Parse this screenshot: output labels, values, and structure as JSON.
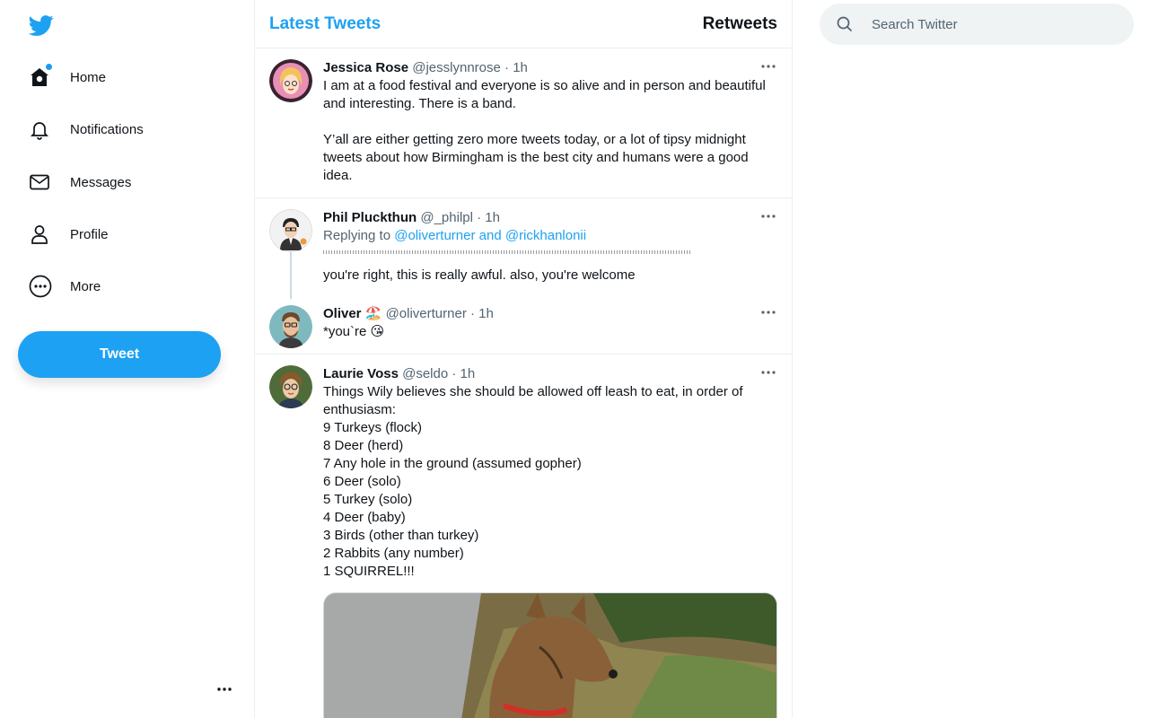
{
  "sidebar": {
    "items": [
      {
        "label": "Home",
        "icon": "home-icon"
      },
      {
        "label": "Notifications",
        "icon": "bell-icon"
      },
      {
        "label": "Messages",
        "icon": "envelope-icon"
      },
      {
        "label": "Profile",
        "icon": "person-icon"
      },
      {
        "label": "More",
        "icon": "more-circle-icon"
      }
    ],
    "tweet_button": "Tweet"
  },
  "header": {
    "tab_latest": "Latest Tweets",
    "tab_retweets": "Retweets"
  },
  "search": {
    "placeholder": "Search Twitter"
  },
  "tweets": [
    {
      "name": "Jessica Rose",
      "handle": "@jesslynnrose",
      "sep": " · ",
      "time": "1h",
      "text": "I am at a food festival and everyone is so alive and in person and beautiful\nand interesting. There is a band.\n\nY’all are either getting zero more tweets today, or a lot of tipsy midnight\ntweets about how Birmingham is the best city and humans were a good\nidea."
    },
    {
      "name": "Phil Pluckthun",
      "handle": "@_philpl",
      "sep": " · ",
      "time": "1h",
      "replying_prefix": "Replying to ",
      "replying_users": "@oliverturner and @rickhanlonii",
      "text": "you're right, this is really awful. also, you're welcome"
    },
    {
      "name": "Oliver",
      "name_emoji": "🏖️",
      "handle": "@oliverturner",
      "sep": " · ",
      "time": "1h",
      "text": "*you`re 😘"
    },
    {
      "name": "Laurie Voss",
      "handle": "@seldo",
      "sep": " · ",
      "time": "1h",
      "text": "Things Wily believes she should be allowed off leash to eat, in order of\nenthusiasm:\n9 Turkeys (flock)\n8 Deer (herd)\n7 Any hole in the ground (assumed gopher)\n6 Deer (solo)\n5 Turkey (solo)\n4 Deer (baby)\n3 Birds (other than turkey)\n2 Rabbits (any number)\n1 SQUIRREL!!!"
    }
  ],
  "colors": {
    "accent": "#1da1f2",
    "text": "#0f1419",
    "muted": "#536471"
  }
}
